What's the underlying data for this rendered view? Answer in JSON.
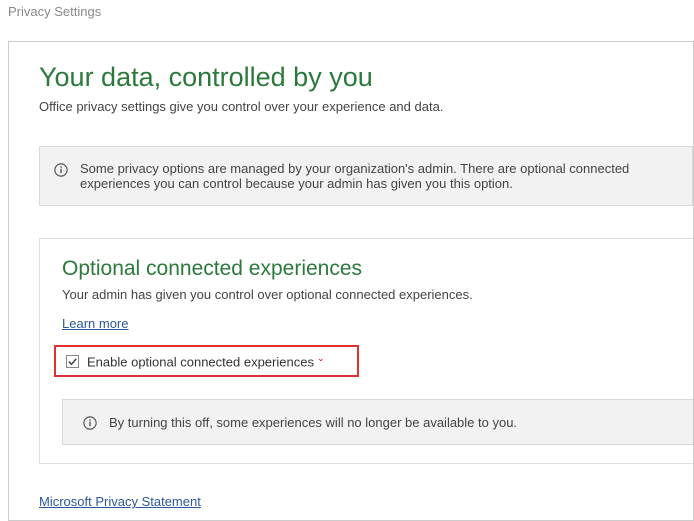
{
  "window_title": "Privacy Settings",
  "main": {
    "heading": "Your data, controlled by you",
    "description": "Office privacy settings give you control over your experience and data."
  },
  "admin_notice": "Some privacy options are managed by your organization's admin. There are optional connected experiences you can control because your admin has given you this option.",
  "section": {
    "heading": "Optional connected experiences",
    "description": "Your admin has given you control over optional connected experiences.",
    "learn_more": "Learn more",
    "checkbox_label": "Enable optional connected experiences",
    "warning": "By turning this off, some experiences will no longer be available to you."
  },
  "footer_link": "Microsoft Privacy Statement"
}
